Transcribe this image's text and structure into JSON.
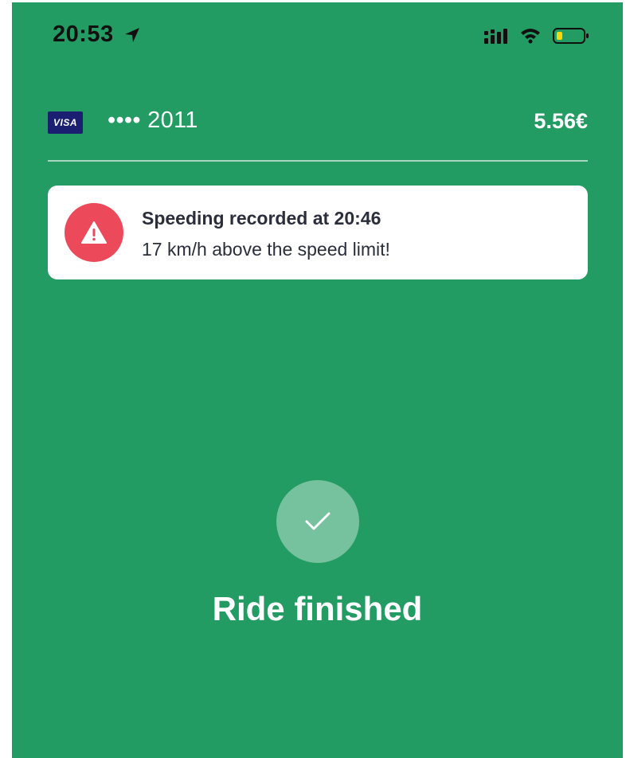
{
  "status_bar": {
    "time": "20:53",
    "icons": [
      "location-arrow-icon",
      "signal-icon",
      "wifi-icon",
      "battery-icon"
    ]
  },
  "payment": {
    "card_brand": "VISA",
    "card_number": "•••• 2011",
    "price": "5.56€"
  },
  "warning": {
    "icon": "warning-triangle-icon",
    "title": "Speeding recorded at 20:46",
    "message": "17 km/h above the speed limit!"
  },
  "result": {
    "icon": "checkmark-icon",
    "title": "Ride finished"
  },
  "colors": {
    "background": "#239c63",
    "warning": "#ec4a5a",
    "battery_low": "#f5d90a"
  }
}
